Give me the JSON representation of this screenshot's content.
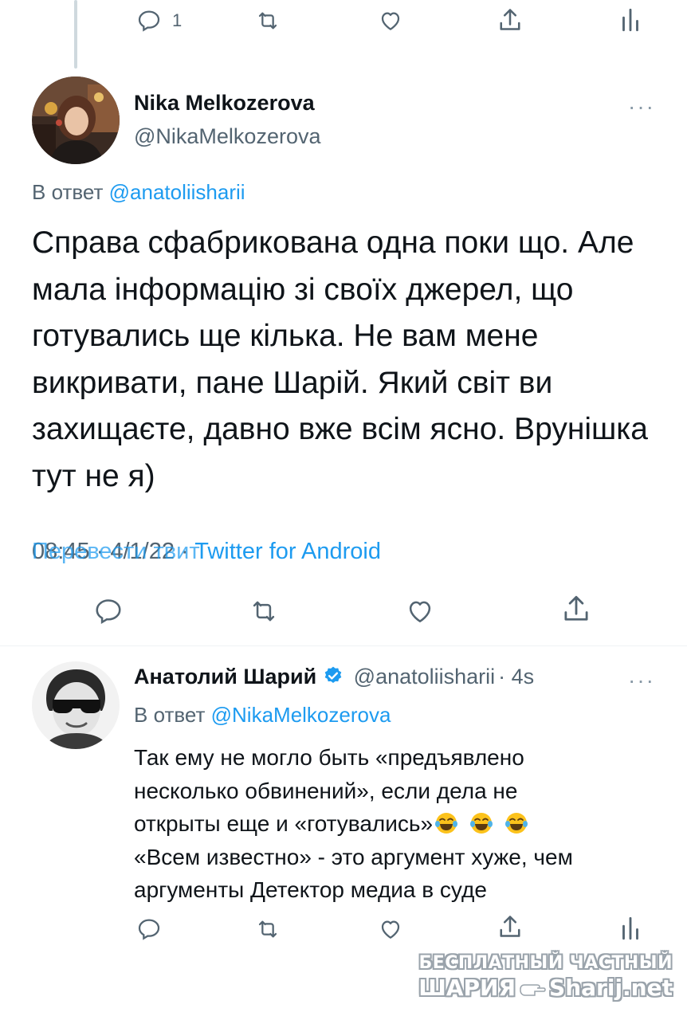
{
  "top_actions": {
    "reply_count": "1"
  },
  "tweet": {
    "author_name": "Nika Melkozerova",
    "author_handle": "@NikaMelkozerova",
    "more": "···",
    "reply_prefix": "В ответ",
    "reply_mention": "@anatoliisharii",
    "text": "Справа сфабрикована одна поки що. Але мала інформацію зі своїх джерел, що готувались ще кілька. Не вам мене викривати, пане Шарій. Який світ ви захищаєте, давно вже всім ясно. Врунішка тут не я)",
    "translate_label": "Перевести твит",
    "time": "08:45 · 4/1/22",
    "separator": " · ",
    "source": "Twitter for Android"
  },
  "reply": {
    "author_name": "Анатолий Шарий",
    "author_handle": "@anatoliisharii",
    "age": "· 4s",
    "more": "···",
    "reply_prefix": "В ответ",
    "reply_mention": "@NikaMelkozerova",
    "lines": [
      "Так ему не могло быть «предъявлено",
      "несколько обвинений», если дела не",
      "открыты еще и «готувались»",
      "«Всем известно» - это аргумент хуже, чем",
      "аргументы Детектор медиа в суде"
    ]
  },
  "watermark": {
    "line1": "БЕСПЛАТНЫЙ ЧАСТНЫЙ",
    "line2_left": "ШАРИЯ",
    "line2_right": "Sharij.net"
  },
  "icons": [
    "reply-icon",
    "retweet-icon",
    "like-icon",
    "share-icon",
    "analytics-icon",
    "verified-icon",
    "laughing-emoji-icon",
    "pointing-hand-icon"
  ],
  "colors": {
    "accent": "#1d9bf0",
    "secondary_text": "#536471",
    "verified": "#1d9bf0"
  }
}
